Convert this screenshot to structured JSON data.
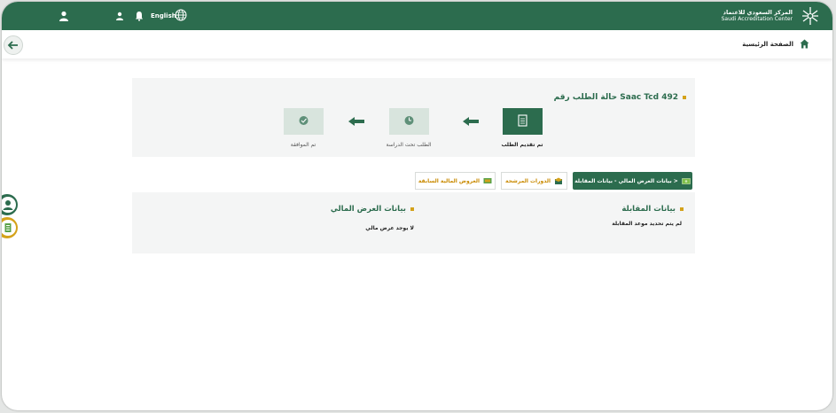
{
  "header": {
    "language_label": "English",
    "logo_ar": "المركز السعودي للاعتماد",
    "logo_en": "Saudi Accreditation Center"
  },
  "nav": {
    "home_label": "الصفحة الرئيسية"
  },
  "request": {
    "title": "حالة الطلب رقم Saac Tcd 492",
    "steps": [
      {
        "label": "تم تقديم الطلب",
        "active": true,
        "icon": "document-icon"
      },
      {
        "label": "الطلب تحت الدراسة",
        "active": false,
        "icon": "clock-icon"
      },
      {
        "label": "تم الموافقة",
        "active": false,
        "icon": "check-icon"
      }
    ]
  },
  "tabs": [
    {
      "label": "بيانات العرض المالي - بيانات المقابلة >",
      "active": true
    },
    {
      "label": "الدورات المرشحة",
      "active": false
    },
    {
      "label": "العروض المالية السابقة",
      "active": false
    }
  ],
  "interview": {
    "title": "بيانات المقابلة",
    "text": "لم يتم تحديد موعد المقابلة"
  },
  "financial": {
    "title": "بيانات العرض المالي",
    "text": "لا يوجد عرض مالي"
  },
  "colors": {
    "primary": "#2c6c4e",
    "accent": "#d4a21a",
    "tab_text": "#c98a00"
  }
}
